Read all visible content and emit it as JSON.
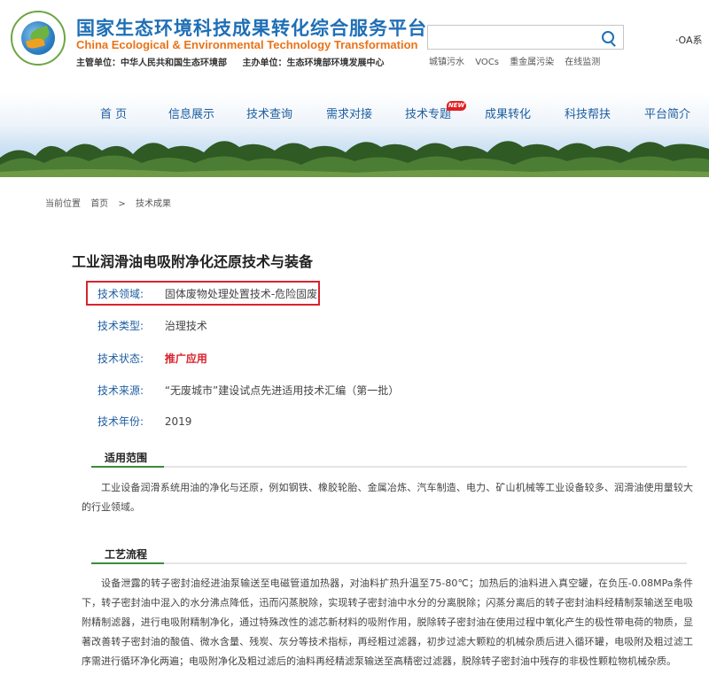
{
  "header": {
    "title_cn": "国家生态环境科技成果转化综合服务平台",
    "title_en": "China Ecological & Environmental Technology Transformation",
    "org_supervisor": "主管单位：中华人民共和国生态环境部",
    "org_host": "主办单位：生态环境部环境发展中心",
    "search_placeholder": "",
    "oa_link": "·OA系",
    "hot_tags": [
      "城镇污水",
      "VOCs",
      "重金属污染",
      "在线监测"
    ]
  },
  "nav": {
    "items": [
      "首  页",
      "信息展示",
      "技术查询",
      "需求对接",
      "技术专题",
      "成果转化",
      "科技帮扶",
      "平台简介"
    ],
    "new_badge": "NEW"
  },
  "breadcrumb": {
    "label": "当前位置",
    "home": "首页",
    "sep": ">",
    "current": "技术成果"
  },
  "article": {
    "title": "工业润滑油电吸附净化还原技术与装备",
    "fields": [
      {
        "label": "技术领域:",
        "value": "固体废物处理处置技术-危险固废"
      },
      {
        "label": "技术类型:",
        "value": "治理技术"
      },
      {
        "label": "技术状态:",
        "value": "推广应用"
      },
      {
        "label": "技术来源:",
        "value": "“无废城市”建设试点先进适用技术汇编（第一批）"
      },
      {
        "label": "技术年份:",
        "value": "2019"
      }
    ],
    "sections": [
      {
        "heading": "适用范围",
        "text": "工业设备润滑系统用油的净化与还原，例如钢铁、橡胶轮胎、金属冶炼、汽车制造、电力、矿山机械等工业设备较多、润滑油使用量较大的行业领域。"
      },
      {
        "heading": "工艺流程",
        "text": "设备泄露的转子密封油经进油泵输送至电磁管道加热器，对油料扩热升温至75-80℃；加热后的油料进入真空罐，在负压-0.08MPa条件下，转子密封油中混入的水分沸点降低，迅而闪蒸脱除，实现转子密封油中水分的分离脱除；闪蒸分离后的转子密封油料经精制泵输送至电吸附精制滤器，进行电吸附精制净化，通过特殊改性的滤芯新材料的吸附作用，脱除转子密封油在使用过程中氧化产生的极性带电荷的物质，显著改善转子密封油的酸值、微水含量、残炭、灰分等技术指标，再经粗过滤器，初步过滤大颗粒的机械杂质后进入循环罐，电吸附及粗过滤工序需进行循环净化两遍；电吸附净化及粗过滤后的油料再经精滤泵输送至高精密过滤器，脱除转子密封油中残存的非极性颗粒物机械杂质。"
      }
    ]
  },
  "colors": {
    "brand_blue": "#1f6fb6",
    "brand_orange": "#e8731a",
    "highlight_red": "#d9232d",
    "section_green": "#3d8a3a"
  }
}
